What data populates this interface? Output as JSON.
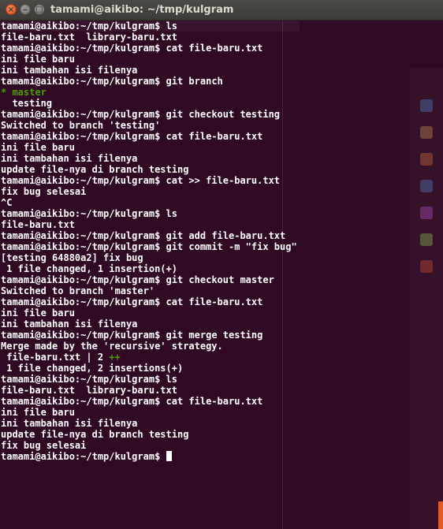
{
  "window": {
    "title": "tamami@aikibo: ~/tmp/kulgram",
    "close_symbol": "×",
    "minimize_symbol": "–",
    "maximize_symbol": "□"
  },
  "terminal": {
    "prompt": "tamami@aikibo:~/tmp/kulgram$",
    "lines": [
      {
        "kind": "cmd",
        "text": " ls"
      },
      {
        "kind": "out",
        "text": "file-baru.txt  library-baru.txt"
      },
      {
        "kind": "cmd",
        "text": " cat file-baru.txt"
      },
      {
        "kind": "out",
        "text": "ini file baru"
      },
      {
        "kind": "out",
        "text": "ini tambahan isi filenya"
      },
      {
        "kind": "cmd",
        "text": " git branch"
      },
      {
        "kind": "green",
        "text": "* master"
      },
      {
        "kind": "out",
        "text": "  testing"
      },
      {
        "kind": "cmd",
        "text": " git checkout testing"
      },
      {
        "kind": "out",
        "text": "Switched to branch 'testing'"
      },
      {
        "kind": "cmd",
        "text": " cat file-baru.txt"
      },
      {
        "kind": "out",
        "text": "ini file baru"
      },
      {
        "kind": "out",
        "text": "ini tambahan isi filenya"
      },
      {
        "kind": "out",
        "text": "update file-nya di branch testing"
      },
      {
        "kind": "cmd",
        "text": " cat >> file-baru.txt"
      },
      {
        "kind": "out",
        "text": "fix bug selesai"
      },
      {
        "kind": "out",
        "text": "^C"
      },
      {
        "kind": "cmd",
        "text": " ls"
      },
      {
        "kind": "out",
        "text": "file-baru.txt"
      },
      {
        "kind": "cmd",
        "text": " git add file-baru.txt"
      },
      {
        "kind": "cmd",
        "text": " git commit -m \"fix bug\""
      },
      {
        "kind": "out",
        "text": "[testing 64880a2] fix bug"
      },
      {
        "kind": "out",
        "text": " 1 file changed, 1 insertion(+)"
      },
      {
        "kind": "cmd",
        "text": " git checkout master"
      },
      {
        "kind": "out",
        "text": "Switched to branch 'master'"
      },
      {
        "kind": "cmd",
        "text": " cat file-baru.txt"
      },
      {
        "kind": "out",
        "text": "ini file baru"
      },
      {
        "kind": "out",
        "text": "ini tambahan isi filenya"
      },
      {
        "kind": "cmd",
        "text": " git merge testing"
      },
      {
        "kind": "out",
        "text": "Merge made by the 'recursive' strategy."
      },
      {
        "kind": "stat",
        "text": " file-baru.txt | 2 ",
        "extra": "++"
      },
      {
        "kind": "out",
        "text": " 1 file changed, 2 insertions(+)"
      },
      {
        "kind": "cmd",
        "text": " ls"
      },
      {
        "kind": "out",
        "text": "file-baru.txt  library-baru.txt"
      },
      {
        "kind": "cmd",
        "text": " cat file-baru.txt"
      },
      {
        "kind": "out",
        "text": "ini file baru"
      },
      {
        "kind": "out",
        "text": "ini tambahan isi filenya"
      },
      {
        "kind": "out",
        "text": "update file-nya di branch testing"
      },
      {
        "kind": "out",
        "text": "fix bug selesai"
      },
      {
        "kind": "cursor",
        "text": " "
      }
    ]
  },
  "colors": {
    "background": "#300a24",
    "text": "#ffffff",
    "green": "#4e9a06"
  }
}
